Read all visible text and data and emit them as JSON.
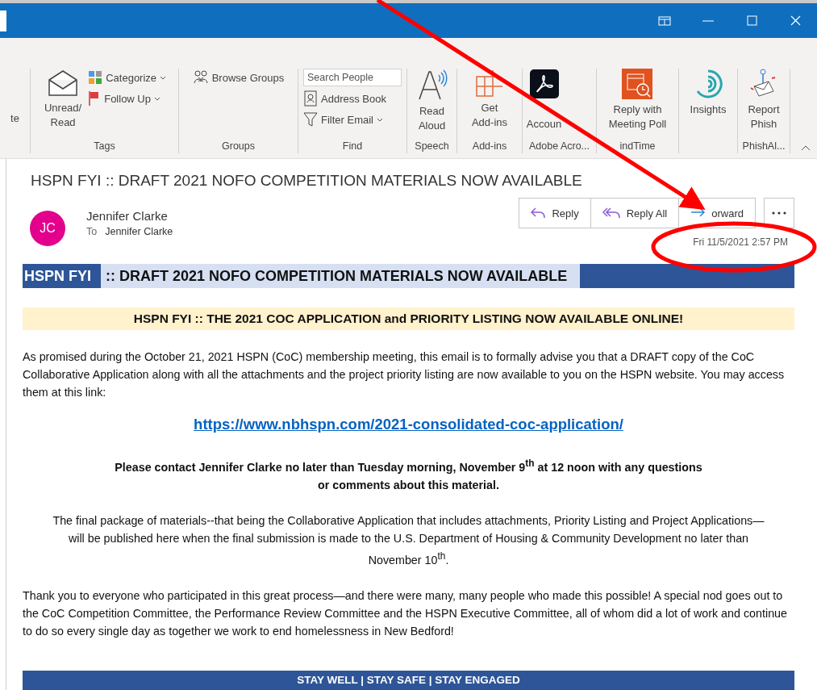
{
  "ribbon": {
    "groups": [
      {
        "items": [
          {
            "kind": "cut",
            "label": "te"
          }
        ]
      },
      {
        "label": "Tags",
        "items": [
          {
            "kind": "large",
            "label": "Unread/\nRead"
          },
          {
            "kind": "small",
            "label": "Categorize",
            "dropdown": true
          },
          {
            "kind": "small",
            "label": "Follow Up",
            "dropdown": true
          }
        ]
      },
      {
        "label": "Groups",
        "items": [
          {
            "kind": "small",
            "label": "Browse Groups",
            "dropdown": false
          }
        ]
      },
      {
        "label": "Find",
        "items": [
          {
            "kind": "search",
            "placeholder": "Search People"
          },
          {
            "kind": "small",
            "label": "Address Book",
            "dropdown": false
          },
          {
            "kind": "small",
            "label": "Filter Email",
            "dropdown": true
          }
        ]
      },
      {
        "label": "Speech",
        "items": [
          {
            "kind": "large",
            "label": "Read\nAloud"
          }
        ]
      },
      {
        "label": "Add-ins",
        "items": [
          {
            "kind": "large",
            "label": "Get\nAdd-ins"
          }
        ]
      },
      {
        "label": "Adobe Acro...",
        "items": [
          {
            "kind": "large",
            "label": "\nAccoun"
          }
        ]
      },
      {
        "label": "indTime",
        "items": [
          {
            "kind": "large",
            "label": "Reply with\nMeeting Poll"
          }
        ]
      },
      {
        "items": [
          {
            "kind": "large",
            "label": "Insights"
          }
        ]
      },
      {
        "label": "PhishAl...",
        "items": [
          {
            "kind": "large",
            "label": "Report\nPhish"
          }
        ]
      }
    ]
  },
  "message": {
    "subject": "HSPN FYI :: DRAFT 2021 NOFO COMPETITION MATERIALS NOW AVAILABLE",
    "sender": {
      "initials": "JC",
      "name": "Jennifer Clarke"
    },
    "to_label": "To",
    "to": "Jennifer Clarke",
    "actions": [
      {
        "label": "Reply"
      },
      {
        "label": "Reply All"
      },
      {
        "label": "orward"
      }
    ],
    "date": "Fri 11/5/2021 2:57 PM"
  },
  "body": {
    "banner": {
      "tag": "HSPN FYI",
      "text": ":: DRAFT 2021 NOFO COMPETITION MATERIALS NOW AVAILABLE"
    },
    "headline": "HSPN FYI :: THE 2021 COC APPLICATION and PRIORITY LISTING NOW AVAILABLE ONLINE!",
    "blocks": [
      {
        "kind": "para",
        "text": "As promised during the October 21, 2021 HSPN (CoC) membership meeting, this email is to formally advise you that a DRAFT copy of the CoC Collaborative Application along with all the attachments and the project priority listing are now available to you on the HSPN website.  You may access them at this link:"
      },
      {
        "kind": "link",
        "text": "https://www.nbhspn.com/2021-consolidated-coc-application/"
      },
      {
        "kind": "bold",
        "text": "Please contact Jennifer Clarke no later than Tuesday morning, November 9$^{th}$ at 12 noon with any questions or comments about this material."
      },
      {
        "kind": "center",
        "text": "The final package of materials--that being the Collaborative Application that includes attachments, Priority Listing and Project Applications—will be published here when the final submission is made to the U.S. Department of Housing & Community Development no later than November 10$^{th}$."
      },
      {
        "kind": "para",
        "text": "Thank you to everyone who participated in this great process—and there were many, many people who made this possible!  A special nod goes out to the CoC Competition Committee, the Performance Review Committee and the HSPN Executive Committee, all of whom did a lot of work and continue to do so every single day as together we work to end homelessness in New Bedford!"
      }
    ],
    "footer": "STAY WELL | STAY SAFE | STAY ENGAGED"
  }
}
